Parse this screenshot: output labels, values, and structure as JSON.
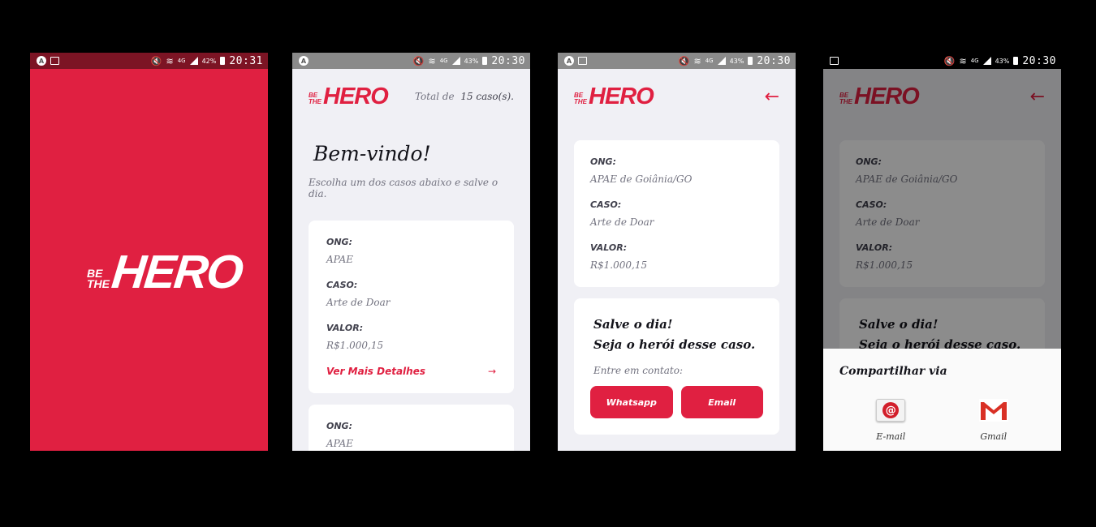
{
  "status_bars": {
    "s1": {
      "time": "20:31",
      "battery": "42%",
      "network": "4G"
    },
    "s2": {
      "time": "20:30",
      "battery": "43%",
      "network": "4G"
    },
    "s3": {
      "time": "20:30",
      "battery": "43%",
      "network": "4G"
    },
    "s4": {
      "time": "20:30",
      "battery": "43%",
      "network": "4G"
    }
  },
  "logo": {
    "top": "BE",
    "middle": "THE",
    "main": "HERO"
  },
  "colors": {
    "brand": "#e02041",
    "background": "#f0f0f5",
    "card": "#ffffff"
  },
  "icons": {
    "back": "arrow-left-icon",
    "details": "arrow-right-icon",
    "email": "email-icon",
    "gmail": "gmail-icon"
  },
  "list_screen": {
    "total_prefix": "Total de",
    "total_count": "15 caso(s).",
    "title": "Bem-vindo!",
    "description": "Escolha um dos casos abaixo e salve o dia.",
    "incidents": [
      {
        "ong_label": "ONG:",
        "ong": "APAE",
        "caso_label": "CASO:",
        "caso": "Arte de Doar",
        "valor_label": "VALOR:",
        "valor": "R$1.000,15",
        "link": "Ver Mais Detalhes"
      },
      {
        "ong_label": "ONG:",
        "ong": "APAE"
      }
    ]
  },
  "detail_screen": {
    "ong_label": "ONG:",
    "ong": "APAE de Goiânia/GO",
    "caso_label": "CASO:",
    "caso": "Arte de Doar",
    "valor_label": "VALOR:",
    "valor": "R$1.000,15",
    "hero_title_1": "Salve o dia!",
    "hero_title_2": "Seja o herói desse caso.",
    "contact_desc": "Entre em contato:",
    "whatsapp": "Whatsapp",
    "email": "Email"
  },
  "share_sheet": {
    "title": "Compartilhar via",
    "options": [
      "E-mail",
      "Gmail"
    ]
  }
}
